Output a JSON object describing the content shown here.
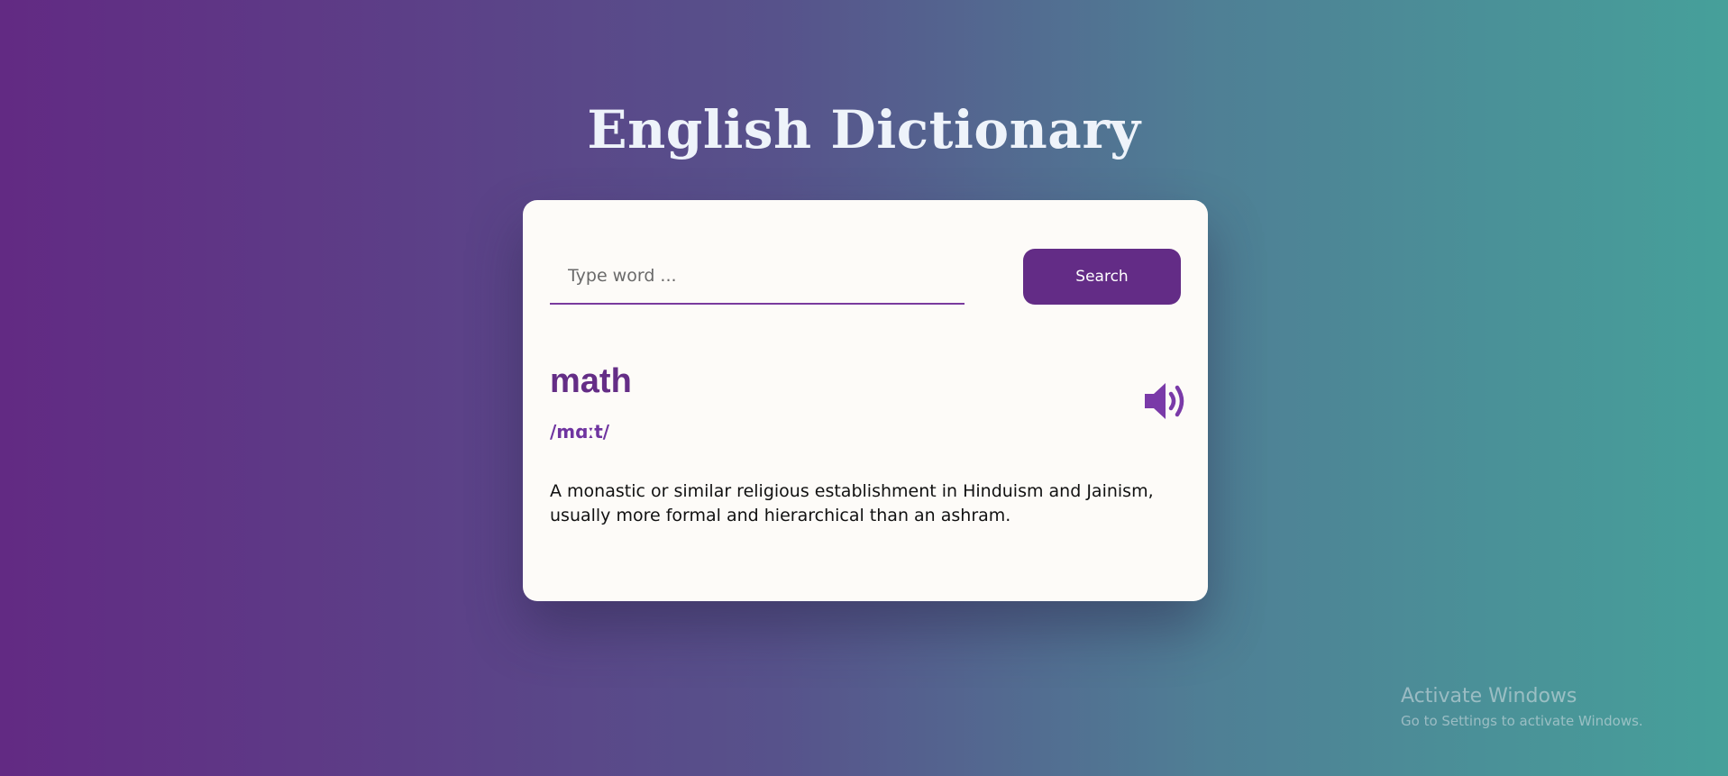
{
  "header": {
    "title": "English Dictionary"
  },
  "search": {
    "placeholder": "Type word ...",
    "value": "",
    "button_label": "Search"
  },
  "result": {
    "word": "math",
    "phonetic": "/mɑːt/",
    "definition": "A monastic or similar religious establishment in Hinduism and Jainism, usually more formal and hierarchical than an ashram.",
    "audio_icon": "speaker-volume-icon"
  },
  "watermark": {
    "title": "Activate Windows",
    "subtitle": "Go to Settings to activate Windows."
  },
  "colors": {
    "accent": "#632c86",
    "card_background": "#fdfbf8",
    "background_start": "#622a83",
    "background_end": "#46a09a"
  }
}
